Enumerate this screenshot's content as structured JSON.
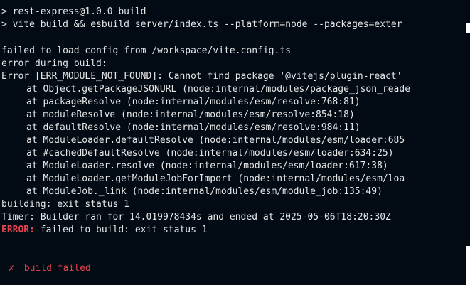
{
  "terminal": {
    "command_lines": [
      "> rest-express@1.0.0 build",
      "> vite build && esbuild server/index.ts --platform=node --packages=exter"
    ],
    "output": {
      "config_error": "failed to load config from /workspace/vite.config.ts",
      "during_build": "error during build:",
      "error_message": "Error [ERR_MODULE_NOT_FOUND]: Cannot find package '@vitejs/plugin-react'",
      "stack": [
        "at Object.getPackageJSONURL (node:internal/modules/package_json_reade",
        "at packageResolve (node:internal/modules/esm/resolve:768:81)",
        "at moduleResolve (node:internal/modules/esm/resolve:854:18)",
        "at defaultResolve (node:internal/modules/esm/resolve:984:11)",
        "at ModuleLoader.defaultResolve (node:internal/modules/esm/loader:685",
        "at #cachedDefaultResolve (node:internal/modules/esm/loader:634:25)",
        "at ModuleLoader.resolve (node:internal/modules/esm/loader:617:38)",
        "at ModuleLoader.getModuleJobForImport (node:internal/modules/esm/loa",
        "at ModuleJob._link (node:internal/modules/esm/module_job:135:49)"
      ],
      "exit_status": "building: exit status 1",
      "timer": "Timer: Builder ran for 14.019978434s and ended at 2025-05-06T18:20:30Z",
      "final_error_prefix": "ERROR:",
      "final_error_text": " failed to build: exit status 1"
    },
    "status": {
      "icon": "x-mark-icon",
      "icon_glyph": "✗",
      "text": "build failed"
    }
  }
}
